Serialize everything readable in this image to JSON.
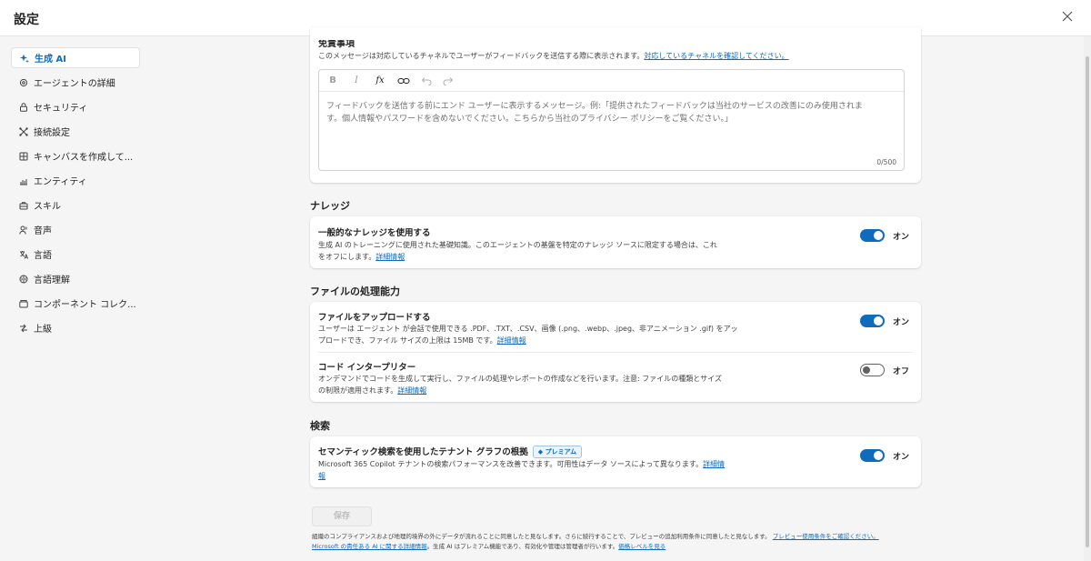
{
  "header": {
    "title": "設定"
  },
  "sidebar": {
    "items": [
      {
        "label": "生成 AI",
        "icon": "sparkle-icon",
        "active": true
      },
      {
        "label": "エージェントの詳細",
        "icon": "gear-icon"
      },
      {
        "label": "セキュリティ",
        "icon": "lock-icon"
      },
      {
        "label": "接続設定",
        "icon": "connection-icon"
      },
      {
        "label": "キャンバスを作成して...",
        "icon": "canvas-icon"
      },
      {
        "label": "エンティティ",
        "icon": "entity-icon"
      },
      {
        "label": "スキル",
        "icon": "toolbox-icon"
      },
      {
        "label": "音声",
        "icon": "person-voice-icon"
      },
      {
        "label": "言語",
        "icon": "language-icon"
      },
      {
        "label": "言語理解",
        "icon": "brain-icon"
      },
      {
        "label": "コンポーネント コレク...",
        "icon": "library-icon"
      },
      {
        "label": "上級",
        "icon": "advanced-icon"
      }
    ]
  },
  "feedback": {
    "heading_partial": "免責事項",
    "description": "このメッセージは対応しているチャネルでユーザーがフィードバックを送信する際に表示されます。",
    "link": "対応しているチャネルを確認してください。",
    "placeholder_line1": "フィードバックを送信する前にエンド ユーザーに表示するメッセージ。例:「提供されたフィードバックは当社のサービスの改善にのみ使用されま",
    "placeholder_line2": "す。個人情報やパスワードを含めないでください。こちらから当社のプライバシー ポリシーをご覧ください。」",
    "counter": "0/500"
  },
  "knowledge": {
    "section": "ナレッジ",
    "title": "一般的なナレッジを使用する",
    "desc_line1": "生成 AI のトレーニングに使用された基礎知識。このエージェントの基盤を特定のナレッジ ソースに限定する場合は、これ",
    "desc_line2": "をオフにします。",
    "link": "詳細情報",
    "state": "オン"
  },
  "files": {
    "section": "ファイルの処理能力",
    "upload_title": "ファイルをアップロードする",
    "upload_desc1": "ユーザーは エージェント が会話で使用できる .PDF、.TXT、.CSV、画像 (.png、.webp、.jpeg、非アニメーション .gif) をアッ",
    "upload_desc2": "プロードでき、ファイル サイズの上限は 15MB です。",
    "upload_link": "詳細情報",
    "upload_state": "オン",
    "code_title": "コード インタープリター",
    "code_desc1": "オンデマンドでコードを生成して実行し、ファイルの処理やレポートの作成などを行います。注意: ファイルの種類とサイズ",
    "code_desc2": "の制限が適用されます。",
    "code_link": "詳細情報",
    "code_state": "オフ"
  },
  "search": {
    "section": "検索",
    "title": "セマンティック検索を使用したテナント グラフの根拠",
    "badge": "プレミアム",
    "desc1": "Microsoft 365 Copilot テナントの検索パフォーマンスを改善できます。可用性はデータ ソースによって異なります。",
    "link_part1": "詳細情",
    "link_part2": "報",
    "state": "オン"
  },
  "save_label": "保存",
  "footer": {
    "line1": "組織のコンプライアンスおよび地理的境界の外にデータが流れることに同意したと見なします。さらに続行することで、プレビューの追加利用条件に同意したと見なします。",
    "line1_link": "プレビュー使用条件をご確認ください。",
    "line2_link1": "Microsoft の責任ある AI に関する詳細情報",
    "line2_text": "。生成 AI はプレミアム機能であり、有効化や管理は管理者が行います。",
    "line2_link2": "価格レベルを見る"
  },
  "colors": {
    "accent": "#0f6cbd",
    "background": "#f5f5f5",
    "card": "#ffffff"
  }
}
